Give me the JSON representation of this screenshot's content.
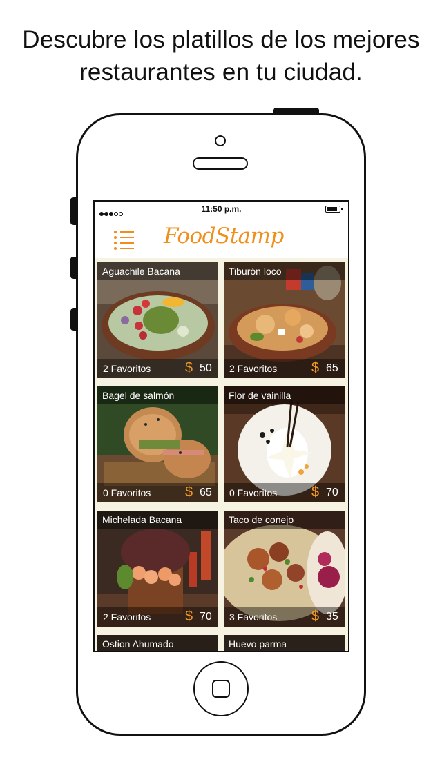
{
  "headline": {
    "line1": "Descubre los platillos de los mejores",
    "line2": "restaurantes en tu ciudad."
  },
  "status_bar": {
    "time": "11:50 p.m."
  },
  "nav": {
    "logo": "FoodStamp",
    "menu_icon": "list-menu-icon"
  },
  "colors": {
    "accent": "#f0901c",
    "background": "#f7f3e2"
  },
  "dishes": [
    {
      "name": "Aguachile Bacana",
      "favorites": "2 Favoritos",
      "currency": "$",
      "price": "50"
    },
    {
      "name": "Tiburón loco",
      "favorites": "2 Favoritos",
      "currency": "$",
      "price": "65"
    },
    {
      "name": "Bagel de salmón",
      "favorites": "0 Favoritos",
      "currency": "$",
      "price": "65"
    },
    {
      "name": "Flor de vainilla",
      "favorites": "0 Favoritos",
      "currency": "$",
      "price": "70"
    },
    {
      "name": "Michelada Bacana",
      "favorites": "2 Favoritos",
      "currency": "$",
      "price": "70"
    },
    {
      "name": "Taco de conejo",
      "favorites": "3 Favoritos",
      "currency": "$",
      "price": "35"
    },
    {
      "name": "Ostion Ahumado"
    },
    {
      "name": "Huevo parma"
    }
  ]
}
